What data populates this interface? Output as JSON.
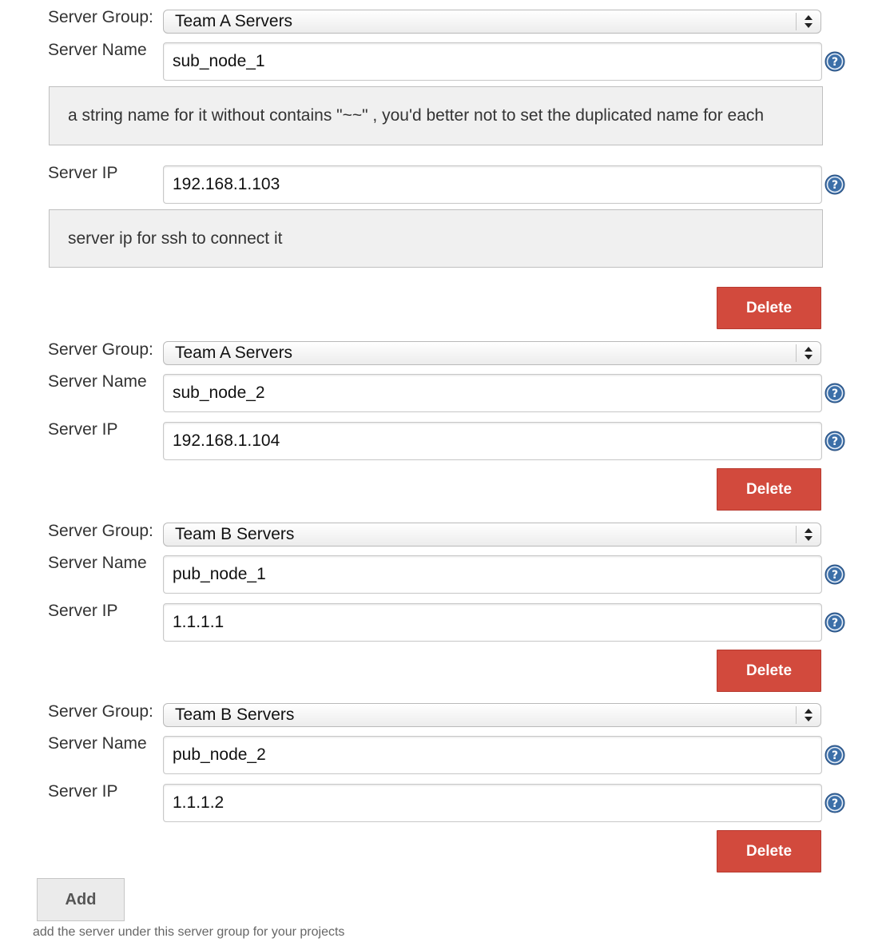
{
  "labels": {
    "server_group": "Server Group:",
    "server_name": "Server Name",
    "server_ip": "Server IP"
  },
  "help_text": {
    "server_name": "a string name for it without contains \"~~\" , you'd better not to set the duplicated name for each",
    "server_ip": "server ip for ssh to connect it"
  },
  "servers": [
    {
      "group": "Team A Servers",
      "name": "sub_node_1",
      "ip": "192.168.1.103",
      "delete_label": "Delete"
    },
    {
      "group": "Team A Servers",
      "name": "sub_node_2",
      "ip": "192.168.1.104",
      "delete_label": "Delete"
    },
    {
      "group": "Team B Servers",
      "name": "pub_node_1",
      "ip": "1.1.1.1",
      "delete_label": "Delete"
    },
    {
      "group": "Team B Servers",
      "name": "pub_node_2",
      "ip": "1.1.1.2",
      "delete_label": "Delete"
    }
  ],
  "add_button": {
    "label": "Add"
  },
  "add_description": "add the server under this server group for your projects",
  "icons": {
    "help": "help-question-icon",
    "select_arrows": "updown-arrows-icon"
  },
  "colors": {
    "delete_button": "#d24a3d",
    "help_icon": "#3c6fa8",
    "help_box_bg": "#f0f0f0"
  }
}
